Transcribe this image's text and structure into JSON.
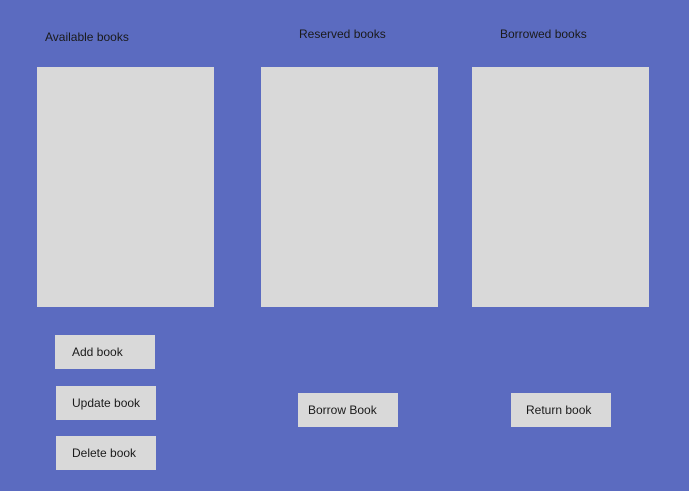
{
  "available": {
    "title": "Available books"
  },
  "reserved": {
    "title": "Reserved books"
  },
  "borrowed": {
    "title": "Borrowed books"
  },
  "actions": {
    "add_label": "Add book",
    "update_label": "Update book",
    "delete_label": "Delete book",
    "borrow_label": "Borrow Book",
    "return_label": "Return book"
  },
  "colors": {
    "background": "#5b6bc0",
    "panel": "#d9d9d9",
    "text": "#1a1a1a"
  }
}
